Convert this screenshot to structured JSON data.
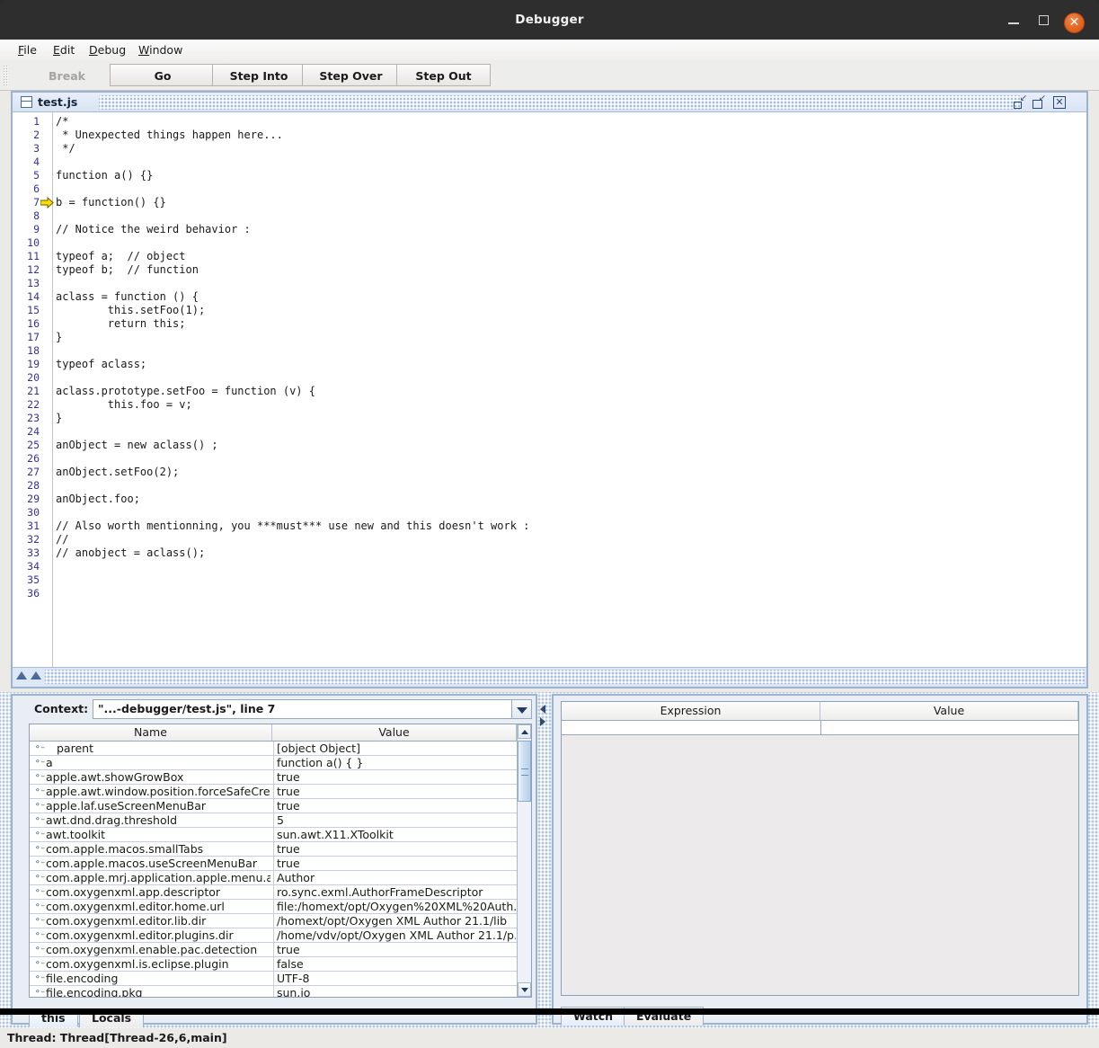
{
  "window": {
    "title": "Debugger",
    "controls": {
      "minimize": "minimize-button",
      "maximize": "maximize-button",
      "close": "✕"
    }
  },
  "menubar": {
    "items": [
      {
        "mnemonic": "F",
        "rest": "ile"
      },
      {
        "mnemonic": "E",
        "rest": "dit"
      },
      {
        "mnemonic": "D",
        "rest": "ebug"
      },
      {
        "mnemonic": "W",
        "rest": "indow"
      }
    ]
  },
  "toolbar": {
    "buttons": [
      {
        "label": "Break",
        "enabled": false
      },
      {
        "label": "Go",
        "enabled": true
      },
      {
        "label": "Step Into",
        "enabled": true
      },
      {
        "label": "Step Over",
        "enabled": true
      },
      {
        "label": "Step Out",
        "enabled": true
      }
    ]
  },
  "editor": {
    "filename": "test.js",
    "current_line": 7,
    "frame_buttons": [
      "restore",
      "maximize",
      "close"
    ],
    "lines": [
      {
        "n": 1,
        "text": "/*"
      },
      {
        "n": 2,
        "text": " * Unexpected things happen here..."
      },
      {
        "n": 3,
        "text": " */"
      },
      {
        "n": 4,
        "text": ""
      },
      {
        "n": 5,
        "text": "function a() {}"
      },
      {
        "n": 6,
        "text": ""
      },
      {
        "n": 7,
        "text": "b = function() {}"
      },
      {
        "n": 8,
        "text": ""
      },
      {
        "n": 9,
        "text": "// Notice the weird behavior :"
      },
      {
        "n": 10,
        "text": ""
      },
      {
        "n": 11,
        "text": "typeof a;  // object"
      },
      {
        "n": 12,
        "text": "typeof b;  // function"
      },
      {
        "n": 13,
        "text": ""
      },
      {
        "n": 14,
        "text": "aclass = function () {"
      },
      {
        "n": 15,
        "text": "        this.setFoo(1);"
      },
      {
        "n": 16,
        "text": "        return this;"
      },
      {
        "n": 17,
        "text": "}"
      },
      {
        "n": 18,
        "text": ""
      },
      {
        "n": 19,
        "text": "typeof aclass;"
      },
      {
        "n": 20,
        "text": ""
      },
      {
        "n": 21,
        "text": "aclass.prototype.setFoo = function (v) {"
      },
      {
        "n": 22,
        "text": "        this.foo = v;"
      },
      {
        "n": 23,
        "text": "}"
      },
      {
        "n": 24,
        "text": ""
      },
      {
        "n": 25,
        "text": "anObject = new aclass() ;"
      },
      {
        "n": 26,
        "text": ""
      },
      {
        "n": 27,
        "text": "anObject.setFoo(2);"
      },
      {
        "n": 28,
        "text": ""
      },
      {
        "n": 29,
        "text": "anObject.foo;"
      },
      {
        "n": 30,
        "text": ""
      },
      {
        "n": 31,
        "text": "// Also worth mentionning, you ***must*** use new and this doesn't work :"
      },
      {
        "n": 32,
        "text": "//"
      },
      {
        "n": 33,
        "text": "// anobject = aclass();"
      },
      {
        "n": 34,
        "text": ""
      },
      {
        "n": 35,
        "text": ""
      },
      {
        "n": 36,
        "text": ""
      }
    ]
  },
  "variables_panel": {
    "context_label": "Context:",
    "context_value": "\"...-debugger/test.js\", line 7",
    "columns": {
      "name": "Name",
      "value": "Value"
    },
    "rows": [
      {
        "name": "parent",
        "value": "[object Object]",
        "indent": true
      },
      {
        "name": "a",
        "value": " function a() { }",
        "indent": false
      },
      {
        "name": "apple.awt.showGrowBox",
        "value": "true",
        "indent": false
      },
      {
        "name": "apple.awt.window.position.forceSafeCre",
        "value": "true",
        "indent": false
      },
      {
        "name": "apple.laf.useScreenMenuBar",
        "value": "true",
        "indent": false
      },
      {
        "name": "awt.dnd.drag.threshold",
        "value": "5",
        "indent": false
      },
      {
        "name": "awt.toolkit",
        "value": "sun.awt.X11.XToolkit",
        "indent": false
      },
      {
        "name": "com.apple.macos.smallTabs",
        "value": "true",
        "indent": false
      },
      {
        "name": "com.apple.macos.useScreenMenuBar",
        "value": "true",
        "indent": false
      },
      {
        "name": "com.apple.mrj.application.apple.menu.a",
        "value": "Author",
        "indent": false
      },
      {
        "name": "com.oxygenxml.app.descriptor",
        "value": "ro.sync.exml.AuthorFrameDescriptor",
        "indent": false
      },
      {
        "name": "com.oxygenxml.editor.home.url",
        "value": "file:/homext/opt/Oxygen%20XML%20Auth...",
        "indent": false
      },
      {
        "name": "com.oxygenxml.editor.lib.dir",
        "value": "/homext/opt/Oxygen XML Author 21.1/lib",
        "indent": false
      },
      {
        "name": "com.oxygenxml.editor.plugins.dir",
        "value": "/home/vdv/opt/Oxygen XML Author 21.1/p...",
        "indent": false
      },
      {
        "name": "com.oxygenxml.enable.pac.detection",
        "value": "true",
        "indent": false
      },
      {
        "name": "com.oxygenxml.is.eclipse.plugin",
        "value": "false",
        "indent": false
      },
      {
        "name": "file.encoding",
        "value": "UTF-8",
        "indent": false
      },
      {
        "name": "file.encoding.pkg",
        "value": "sun.io",
        "indent": false
      }
    ],
    "tabs": [
      {
        "label": "this",
        "selected": true
      },
      {
        "label": "Locals",
        "selected": false
      }
    ]
  },
  "watch_panel": {
    "columns": {
      "expression": "Expression",
      "value": "Value"
    },
    "rows": [],
    "tabs": [
      {
        "label": "Watch",
        "selected": true
      },
      {
        "label": "Evaluate",
        "selected": false
      }
    ]
  },
  "statusbar": {
    "text": "Thread: Thread[Thread-26,6,main]"
  },
  "colors": {
    "titlebar_bg": "#2e2e2e",
    "close_button": "#e2631f",
    "frame_border": "#9bb2d0",
    "line_number": "#333399",
    "exec_arrow": "#ffdd00",
    "app_bg": "#eceae6"
  }
}
